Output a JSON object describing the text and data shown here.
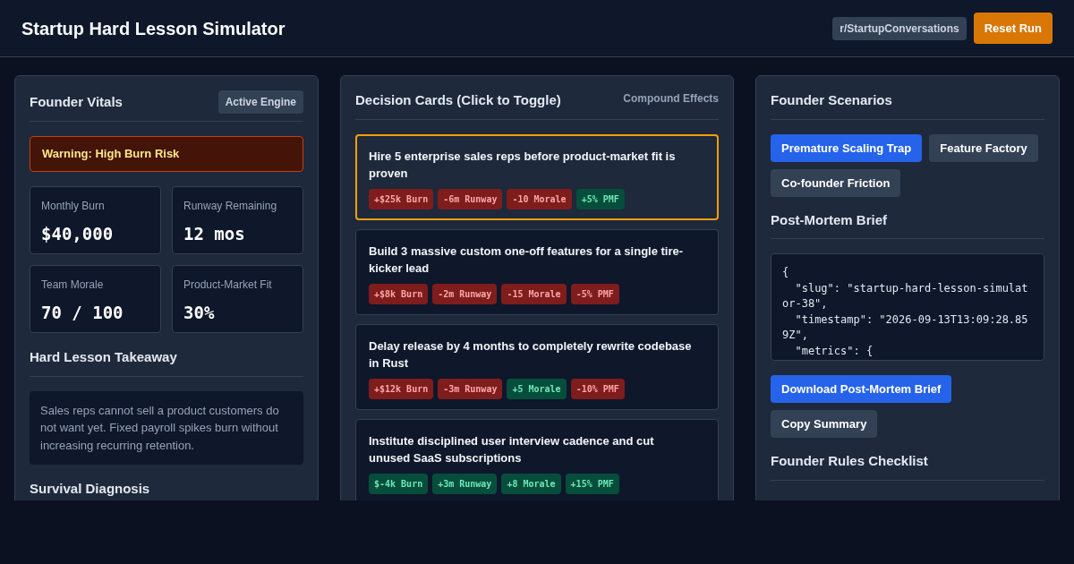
{
  "header": {
    "title": "Startup Hard Lesson Simulator",
    "community_badge": "r/StartupConversations",
    "reset_button": "Reset Run"
  },
  "vitals": {
    "title": "Founder Vitals",
    "badge": "Active Engine",
    "warning": "Warning: High Burn Risk",
    "metrics": [
      {
        "label": "Monthly Burn",
        "value": "$40,000"
      },
      {
        "label": "Runway Remaining",
        "value": "12 mos"
      },
      {
        "label": "Team Morale",
        "value": "70 / 100"
      },
      {
        "label": "Product-Market Fit",
        "value": "30%"
      }
    ],
    "takeaway_title": "Hard Lesson Takeaway",
    "takeaway": "Sales reps cannot sell a product customers do not want yet. Fixed payroll spikes burn without increasing recurring retention.",
    "diagnosis_title": "Survival Diagnosis"
  },
  "decisions": {
    "title": "Decision Cards (Click to Toggle)",
    "subtitle": "Compound Effects",
    "cards": [
      {
        "text": "Hire 5 enterprise sales reps before product-market fit is proven",
        "selected": true,
        "effects": [
          {
            "text": "+$25k Burn",
            "kind": "bad"
          },
          {
            "text": "-6m Runway",
            "kind": "bad"
          },
          {
            "text": "-10 Morale",
            "kind": "bad"
          },
          {
            "text": "+5% PMF",
            "kind": "good"
          }
        ]
      },
      {
        "text": "Build 3 massive custom one-off features for a single tire-kicker lead",
        "selected": false,
        "effects": [
          {
            "text": "+$8k Burn",
            "kind": "bad"
          },
          {
            "text": "-2m Runway",
            "kind": "bad"
          },
          {
            "text": "-15 Morale",
            "kind": "bad"
          },
          {
            "text": "-5% PMF",
            "kind": "bad"
          }
        ]
      },
      {
        "text": "Delay release by 4 months to completely rewrite codebase in Rust",
        "selected": false,
        "effects": [
          {
            "text": "+$12k Burn",
            "kind": "bad"
          },
          {
            "text": "-3m Runway",
            "kind": "bad"
          },
          {
            "text": "+5 Morale",
            "kind": "good"
          },
          {
            "text": "-10% PMF",
            "kind": "bad"
          }
        ]
      },
      {
        "text": "Institute disciplined user interview cadence and cut unused SaaS subscriptions",
        "selected": false,
        "effects": [
          {
            "text": "$-4k Burn",
            "kind": "good"
          },
          {
            "text": "+3m Runway",
            "kind": "good"
          },
          {
            "text": "+8 Morale",
            "kind": "good"
          },
          {
            "text": "+15% PMF",
            "kind": "good"
          }
        ]
      }
    ]
  },
  "scenarios": {
    "title": "Founder Scenarios",
    "items": [
      {
        "label": "Premature Scaling Trap",
        "selected": true
      },
      {
        "label": "Feature Factory",
        "selected": false
      },
      {
        "label": "Co-founder Friction",
        "selected": false
      }
    ],
    "brief_title": "Post-Mortem Brief",
    "brief_code": "{\n  \"slug\": \"startup-hard-lesson-simulator-38\",\n  \"timestamp\": \"2026-09-13T13:09:28.859Z\",\n  \"metrics\": {",
    "download_button": "Download Post-Mortem Brief",
    "copy_button": "Copy Summary",
    "checklist_title": "Founder Rules Checklist"
  }
}
